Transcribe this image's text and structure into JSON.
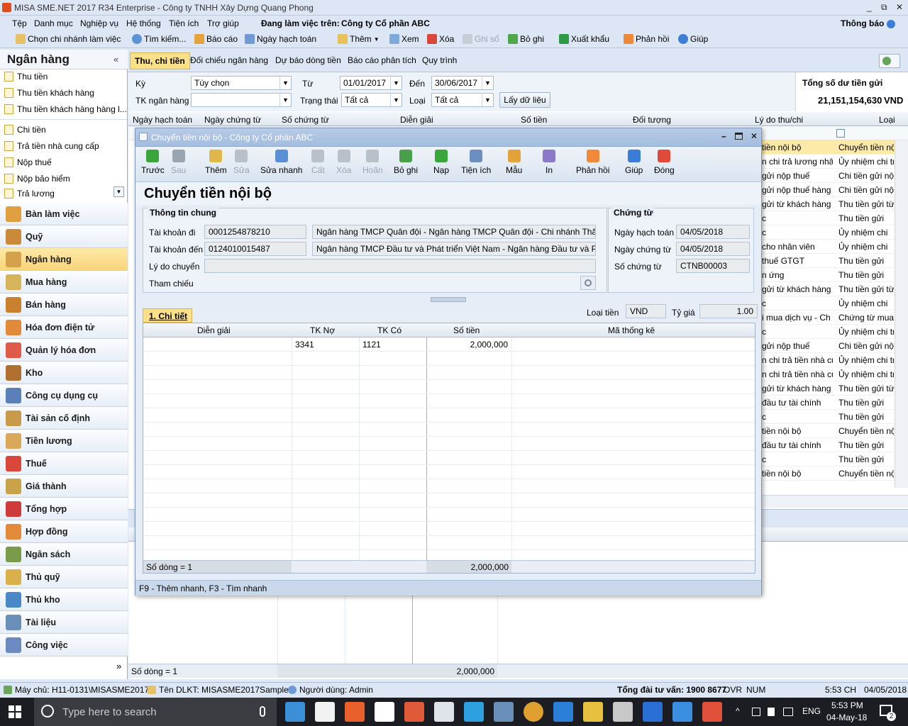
{
  "window": {
    "title": "MISA SME.NET 2017 R34 Enterprise - Công ty TNHH Xây Dựng Quang Phong",
    "controls": [
      "_",
      "⧉",
      "✕"
    ]
  },
  "menu": {
    "items": [
      "Tệp",
      "Danh mục",
      "Nghiệp vụ",
      "Hệ thống",
      "Tiện ích",
      "Trợ giúp"
    ],
    "working_label": "Đang làm việc trên:",
    "working_company": "Công ty Cổ phần ABC",
    "notify": "Thông báo"
  },
  "toolbar": {
    "branch": "Chọn chi nhánh làm việc",
    "search": "Tìm kiếm...",
    "report": "Báo cáo",
    "posting_date": "Ngày hạch toán",
    "add": "Thêm",
    "view": "Xem",
    "delete": "Xóa",
    "post": "Ghi sổ",
    "unpost": "Bỏ ghi",
    "export": "Xuất khẩu",
    "feedback": "Phản hồi",
    "help": "Giúp"
  },
  "sidebar": {
    "title": "Ngân hàng",
    "collapse": "«",
    "items_group1": [
      "Thu tiền",
      "Thu tiền khách hàng",
      "Thu tiền khách hàng hàng l..."
    ],
    "items_group2": [
      "Chi tiền",
      "Trả tiền nhà cung cấp",
      "Nộp thuế",
      "Nộp bảo hiểm",
      "Trả lương"
    ],
    "modules": [
      "Bàn làm việc",
      "Quỹ",
      "Ngân hàng",
      "Mua hàng",
      "Bán hàng",
      "Hóa đơn điện tử",
      "Quản lý hóa đơn",
      "Kho",
      "Công cụ dụng cụ",
      "Tài sản cố định",
      "Tiền lương",
      "Thuế",
      "Giá thành",
      "Tổng hợp",
      "Hợp đồng",
      "Ngân sách",
      "Thủ quỹ",
      "Thủ kho",
      "Tài liệu",
      "Công việc"
    ],
    "active_module": "Ngân hàng",
    "more": "»"
  },
  "main": {
    "tabs": [
      "Thu, chi tiền",
      "Đối chiếu ngân hàng",
      "Dự báo dòng tiền",
      "Báo cáo phân tích",
      "Quy trình"
    ],
    "filters": {
      "period_label": "Kỳ",
      "period_value": "Tùy chọn",
      "from_label": "Từ",
      "from_value": "01/01/2017",
      "to_label": "Đến",
      "to_value": "30/06/2017",
      "account_label": "TK ngân hàng",
      "account_value": "",
      "status_label": "Trạng thái",
      "status_value": "Tất cả",
      "type_label": "Loại",
      "type_value": "Tất cả",
      "load_button": "Lấy dữ liệu"
    },
    "balance": {
      "label": "Tổng số dư tiền gửi",
      "value": "21,151,154,630",
      "currency": "VND"
    },
    "columns": [
      "Ngày hạch toán",
      "Ngày chứng từ",
      "Số chứng từ",
      "Diễn giải",
      "Số tiền",
      "Đối tượng",
      "Lý do thu/chi",
      "Loại"
    ],
    "visible_reason": [
      "tiền nội bộ",
      "n chi trả lương nhân",
      "gửi nộp thuế",
      "gửi nộp thuế hàng n",
      "gửi từ khách hàng",
      "c",
      "c",
      "cho nhân viên",
      "thuế GTGT",
      "n ứng",
      "gửi từ khách hàng",
      "c",
      "i mua dịch vụ - Ch",
      "c",
      "gửi nộp thuế",
      "n chi trả tiền nhà cu",
      "n chi trả tiền nhà cu",
      "gửi từ khách hàng",
      "đầu tư tài chính",
      "c",
      "tiền nội bộ",
      "đầu tư tài chính",
      "c",
      "tiền nội bộ"
    ],
    "visible_type": [
      "Chuyển tiền nội",
      "Ủy nhiệm chi trả",
      "Chi tiền gửi nộp",
      "Chi tiền gửi nộp",
      "Thu tiền gửi từ k",
      "Thu tiền gửi",
      "Ủy nhiệm chi",
      "Ủy nhiệm chi",
      "Thu tiền gửi",
      "Thu tiền gửi",
      "Thu tiền gửi từ k",
      "Ủy nhiệm chi",
      "Chứng từ mua dị",
      "Ủy nhiệm chi trả",
      "Chi tiền gửi nộp",
      "Ủy nhiệm chi trả",
      "Ủy nhiệm chi trả",
      "Thu tiền gửi từ k",
      "Thu tiền gửi",
      "Thu tiền gửi",
      "Chuyển tiền nội",
      "Thu tiền gửi",
      "Thu tiền gửi",
      "Chuyển tiền nội"
    ],
    "footer_count": "Số dòng = 1",
    "footer_total": "2,000,000"
  },
  "dialog": {
    "title": "Chuyển tiền nội bộ - Công ty Cổ phần ABC",
    "toolbar": [
      {
        "label": "Trước",
        "icon": "arrow-left-icon",
        "enabled": true,
        "color": "#3aa53a"
      },
      {
        "label": "Sau",
        "icon": "arrow-right-icon",
        "enabled": false,
        "color": "#9aa5b2"
      },
      {
        "label": "Thêm",
        "icon": "add-document-icon",
        "enabled": true,
        "color": "#e0b84a"
      },
      {
        "label": "Sửa",
        "icon": "edit-icon",
        "enabled": false,
        "color": "#b8c0ca"
      },
      {
        "label": "Sửa nhanh",
        "icon": "quick-edit-icon",
        "enabled": true,
        "color": "#5a8fd6"
      },
      {
        "label": "Cất",
        "icon": "save-icon",
        "enabled": false,
        "color": "#b8c0ca"
      },
      {
        "label": "Xóa",
        "icon": "delete-icon",
        "enabled": false,
        "color": "#b8c0ca"
      },
      {
        "label": "Hoãn",
        "icon": "undo-icon",
        "enabled": false,
        "color": "#b8c0ca"
      },
      {
        "label": "Bỏ ghi",
        "icon": "unpost-icon",
        "enabled": true,
        "color": "#4aa04a"
      },
      {
        "label": "Nạp",
        "icon": "reload-icon",
        "enabled": true,
        "color": "#3aa53a"
      },
      {
        "label": "Tiện ích",
        "icon": "tools-icon",
        "enabled": true,
        "color": "#6c8fc0"
      },
      {
        "label": "Mẫu",
        "icon": "template-icon",
        "enabled": true,
        "color": "#e3a33a"
      },
      {
        "label": "In",
        "icon": "print-icon",
        "enabled": true,
        "color": "#8a7ac8"
      },
      {
        "label": "Phản hồi",
        "icon": "feedback-icon",
        "enabled": true,
        "color": "#f08a3a"
      },
      {
        "label": "Giúp",
        "icon": "help-icon",
        "enabled": true,
        "color": "#3a7cd6"
      },
      {
        "label": "Đóng",
        "icon": "close-icon",
        "enabled": true,
        "color": "#e04a3a"
      }
    ],
    "heading": "Chuyển tiền nội bộ",
    "general": {
      "legend": "Thông tin chung",
      "from_acc_label": "Tài khoản đi",
      "from_acc": "0001254878210",
      "from_bank": "Ngân hàng TMCP Quân đội  - Ngân hàng TMCP Quân đội - Chi nhánh Thăng",
      "to_acc_label": "Tài khoản đến",
      "to_acc": "0124010015487",
      "to_bank": "Ngân hàng TMCP Đầu tư và Phát triển Việt Nam - Ngân hàng Đầu tư và Phát t",
      "reason_label": "Lý do chuyển",
      "reason": "",
      "ref_label": "Tham chiếu"
    },
    "voucher": {
      "legend": "Chứng từ",
      "posting_label": "Ngày hạch toán",
      "posting": "04/05/2018",
      "date_label": "Ngày chứng từ",
      "date": "04/05/2018",
      "no_label": "Số chứng từ",
      "no": "CTNB00003"
    },
    "detail_tab": "1. Chi tiết",
    "currency_label": "Loại tiền",
    "currency": "VND",
    "rate_label": "Tỷ giá",
    "rate": "1.00",
    "grid_columns": [
      "Diễn giải",
      "TK Nợ",
      "TK Có",
      "Số tiền",
      "Mã thống kê"
    ],
    "grid_rows": [
      {
        "desc": "",
        "debit": "3341",
        "credit": "1121",
        "amount": "2,000,000",
        "stat": ""
      }
    ],
    "footer_count": "Số dòng = 1",
    "footer_total": "2,000,000",
    "hint": "F9 - Thêm nhanh, F3 - Tìm nhanh"
  },
  "status": {
    "server": "Máy chủ: H11-0131\\MISASME2017",
    "db": "Tên DLKT: MISASME2017Sample",
    "user": "Người dùng: Admin",
    "hotline": "Tổng đài tư vấn: 1900 8677",
    "ovr": "OVR",
    "num": "NUM",
    "time": "5:53 CH",
    "date": "04/05/2018"
  },
  "taskbar": {
    "search_placeholder": "Type here to search",
    "lang": "ENG",
    "time": "5:53 PM",
    "date": "04-May-18",
    "notif_count": "2"
  }
}
